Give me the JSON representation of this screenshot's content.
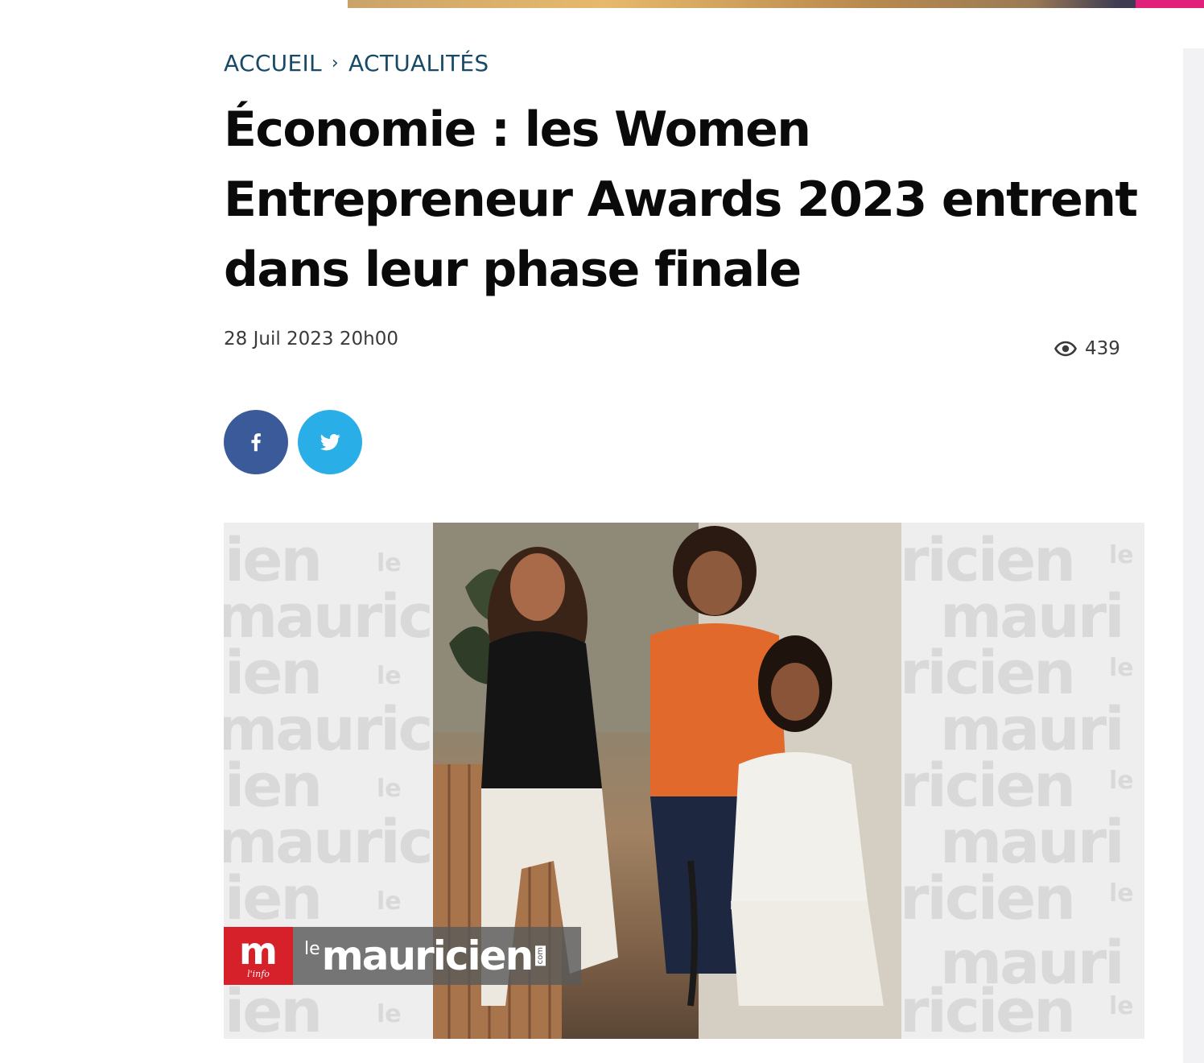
{
  "breadcrumb": {
    "home": "ACCUEIL",
    "separator": "›",
    "section": "ACTUALITÉS"
  },
  "article": {
    "title": "Économie : les Women Entrepreneur Awards 2023 entrent dans leur phase finale",
    "date": "28 Juil 2023 20h00",
    "views": "439"
  },
  "share": {
    "facebook_icon": "facebook-icon",
    "twitter_icon": "twitter-icon"
  },
  "image": {
    "logo_letter": "m",
    "logo_tagline": "l'info",
    "logo_prefix": "le",
    "logo_name": "mauricien",
    "logo_suffix": "com"
  },
  "colors": {
    "breadcrumb": "#174a66",
    "facebook": "#3b5a9a",
    "twitter": "#2aaee7",
    "logo_red": "#d6202a",
    "accent_pink": "#e0207a"
  }
}
